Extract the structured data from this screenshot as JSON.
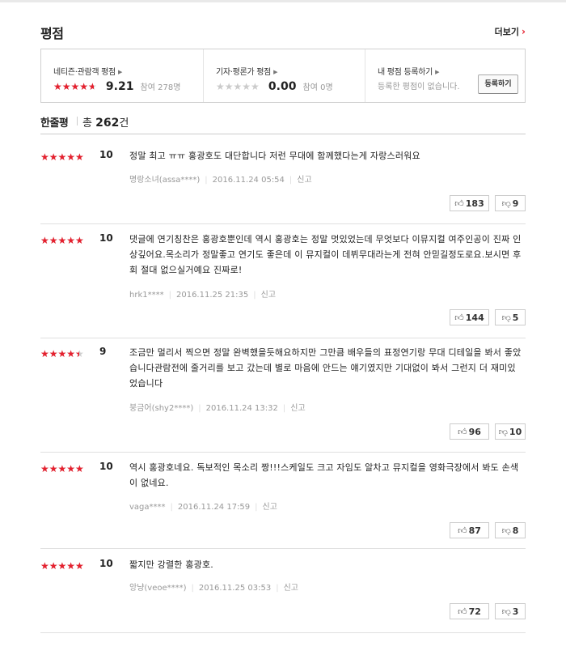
{
  "header": {
    "title": "평점",
    "more_label": "더보기",
    "more_icon": "chevron-right-icon"
  },
  "rating_summary": {
    "netizen": {
      "label": "네티즌·관람객 평점",
      "score": "9.21",
      "participants": "참여 278명",
      "stars_fill": 0.921
    },
    "critic": {
      "label": "기자·평론가 평점",
      "score": "0.00",
      "participants": "참여 0명",
      "stars_fill": 0
    },
    "my_rating": {
      "label": "내 평점 등록하기",
      "desc": "등록한 평점이 없습니다.",
      "button": "등록하기"
    }
  },
  "comment_header": {
    "label": "한줄평",
    "total_prefix": "총",
    "total_count": "262",
    "total_suffix": "건"
  },
  "reviews": [
    {
      "score": "10",
      "stars_fill": 1.0,
      "text": "정말 최고 ㅠㅠ 홍광호도 대단합니다 저런 무대에 함께했다는게 자랑스러워요",
      "author": "명랑소녀(assa****)",
      "date": "2016.11.24 05:54",
      "report": "신고",
      "likes": "183",
      "dislikes": "9"
    },
    {
      "score": "10",
      "stars_fill": 1.0,
      "text": "댓글에 연기칭찬은 홍광호뿐인데 역시 홍광호는 정말 멋있었는데 무엇보다 이뮤지컬 여주인공이 진짜 인상깊어요.목소리가 정말좋고 연기도 좋은데 이 뮤지컬이 데뷔무대라는게 전혀 안믿길정도로요.보시면 후회 절대 없으실거예요 진짜로!",
      "author": "hrk1****",
      "date": "2016.11.25 21:35",
      "report": "신고",
      "likes": "144",
      "dislikes": "5"
    },
    {
      "score": "9",
      "stars_fill": 0.9,
      "text": "조금만 멀리서 찍으면 정말 완벽했을듯해요하지만 그만큼 배우들의 표정연기랑 무대 디테일을 봐서 좋았습니다관람전에 줄거리를 보고 갔는데 별로 마음에 안드는 얘기였지만 기대없이 봐서 그런지 더 재미있었습니다",
      "author": "붕금어(shy2****)",
      "date": "2016.11.24 13:32",
      "report": "신고",
      "likes": "96",
      "dislikes": "10"
    },
    {
      "score": "10",
      "stars_fill": 1.0,
      "text": "역시 홍광호네요. 독보적인 목소리 짱!!!스케일도 크고 자임도 알차고 뮤지컬을 영화극장에서 봐도 손색이 없네요.",
      "author": "vaga****",
      "date": "2016.11.24 17:59",
      "report": "신고",
      "likes": "87",
      "dislikes": "8"
    },
    {
      "score": "10",
      "stars_fill": 1.0,
      "text": "짧지만 강렬한 홍광호.",
      "author": "앙냥(veoe****)",
      "date": "2016.11.25 03:53",
      "report": "신고",
      "likes": "72",
      "dislikes": "3"
    }
  ],
  "icons": {
    "like": "thumbs-up-icon",
    "dislike": "thumbs-down-icon",
    "star": "star-icon"
  },
  "colors": {
    "star_active": "#e5202e",
    "star_inactive": "#cfcfcf",
    "accent": "#e5202e"
  }
}
